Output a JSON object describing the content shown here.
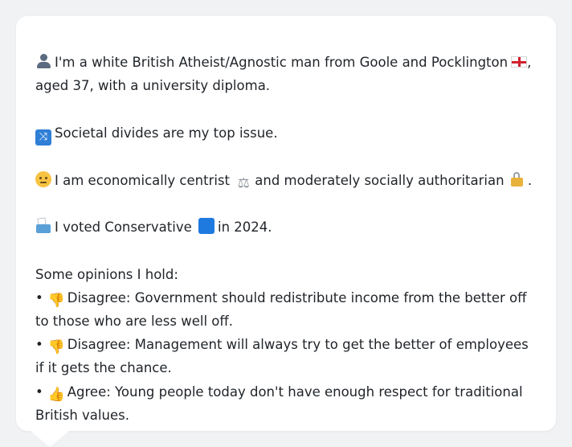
{
  "profile": {
    "line1": "I'm a white British Atheist/Agnostic man from Goole and Pocklington",
    "line1_tail": ",",
    "line1b": "aged 37, with a university diploma.",
    "issue": "Societal divides are my top issue.",
    "stance_a": "I am economically centrist",
    "stance_b": "and moderately socially authoritarian",
    "stance_end": ".",
    "vote_a": "I voted Conservative",
    "vote_b": "in 2024.",
    "opinions_header": "Some opinions I hold:",
    "opinions": [
      {
        "icon": "thumbs-down-icon",
        "text": "Disagree: Government should redistribute income from the better off to those who are less well off."
      },
      {
        "icon": "thumbs-down-icon",
        "text": "Disagree: Management will always try to get the better of employees if it gets the chance."
      },
      {
        "icon": "thumbs-up-icon",
        "text": "Agree: Young people today don't have enough respect for traditional British values."
      }
    ],
    "bullet": "•"
  },
  "icons": {
    "person": "person-icon",
    "flag": "england-flag-icon",
    "shuffle": "shuffle-icon",
    "thinking": "thinking-face-icon",
    "scales": "scales-icon",
    "lock": "lock-icon",
    "ballot": "ballot-box-icon",
    "blue_square": "blue-square-icon"
  },
  "colors": {
    "background": "#f1f2f4",
    "card": "#ffffff",
    "text": "#1f2328",
    "conservative_blue": "#1f7ae0"
  }
}
